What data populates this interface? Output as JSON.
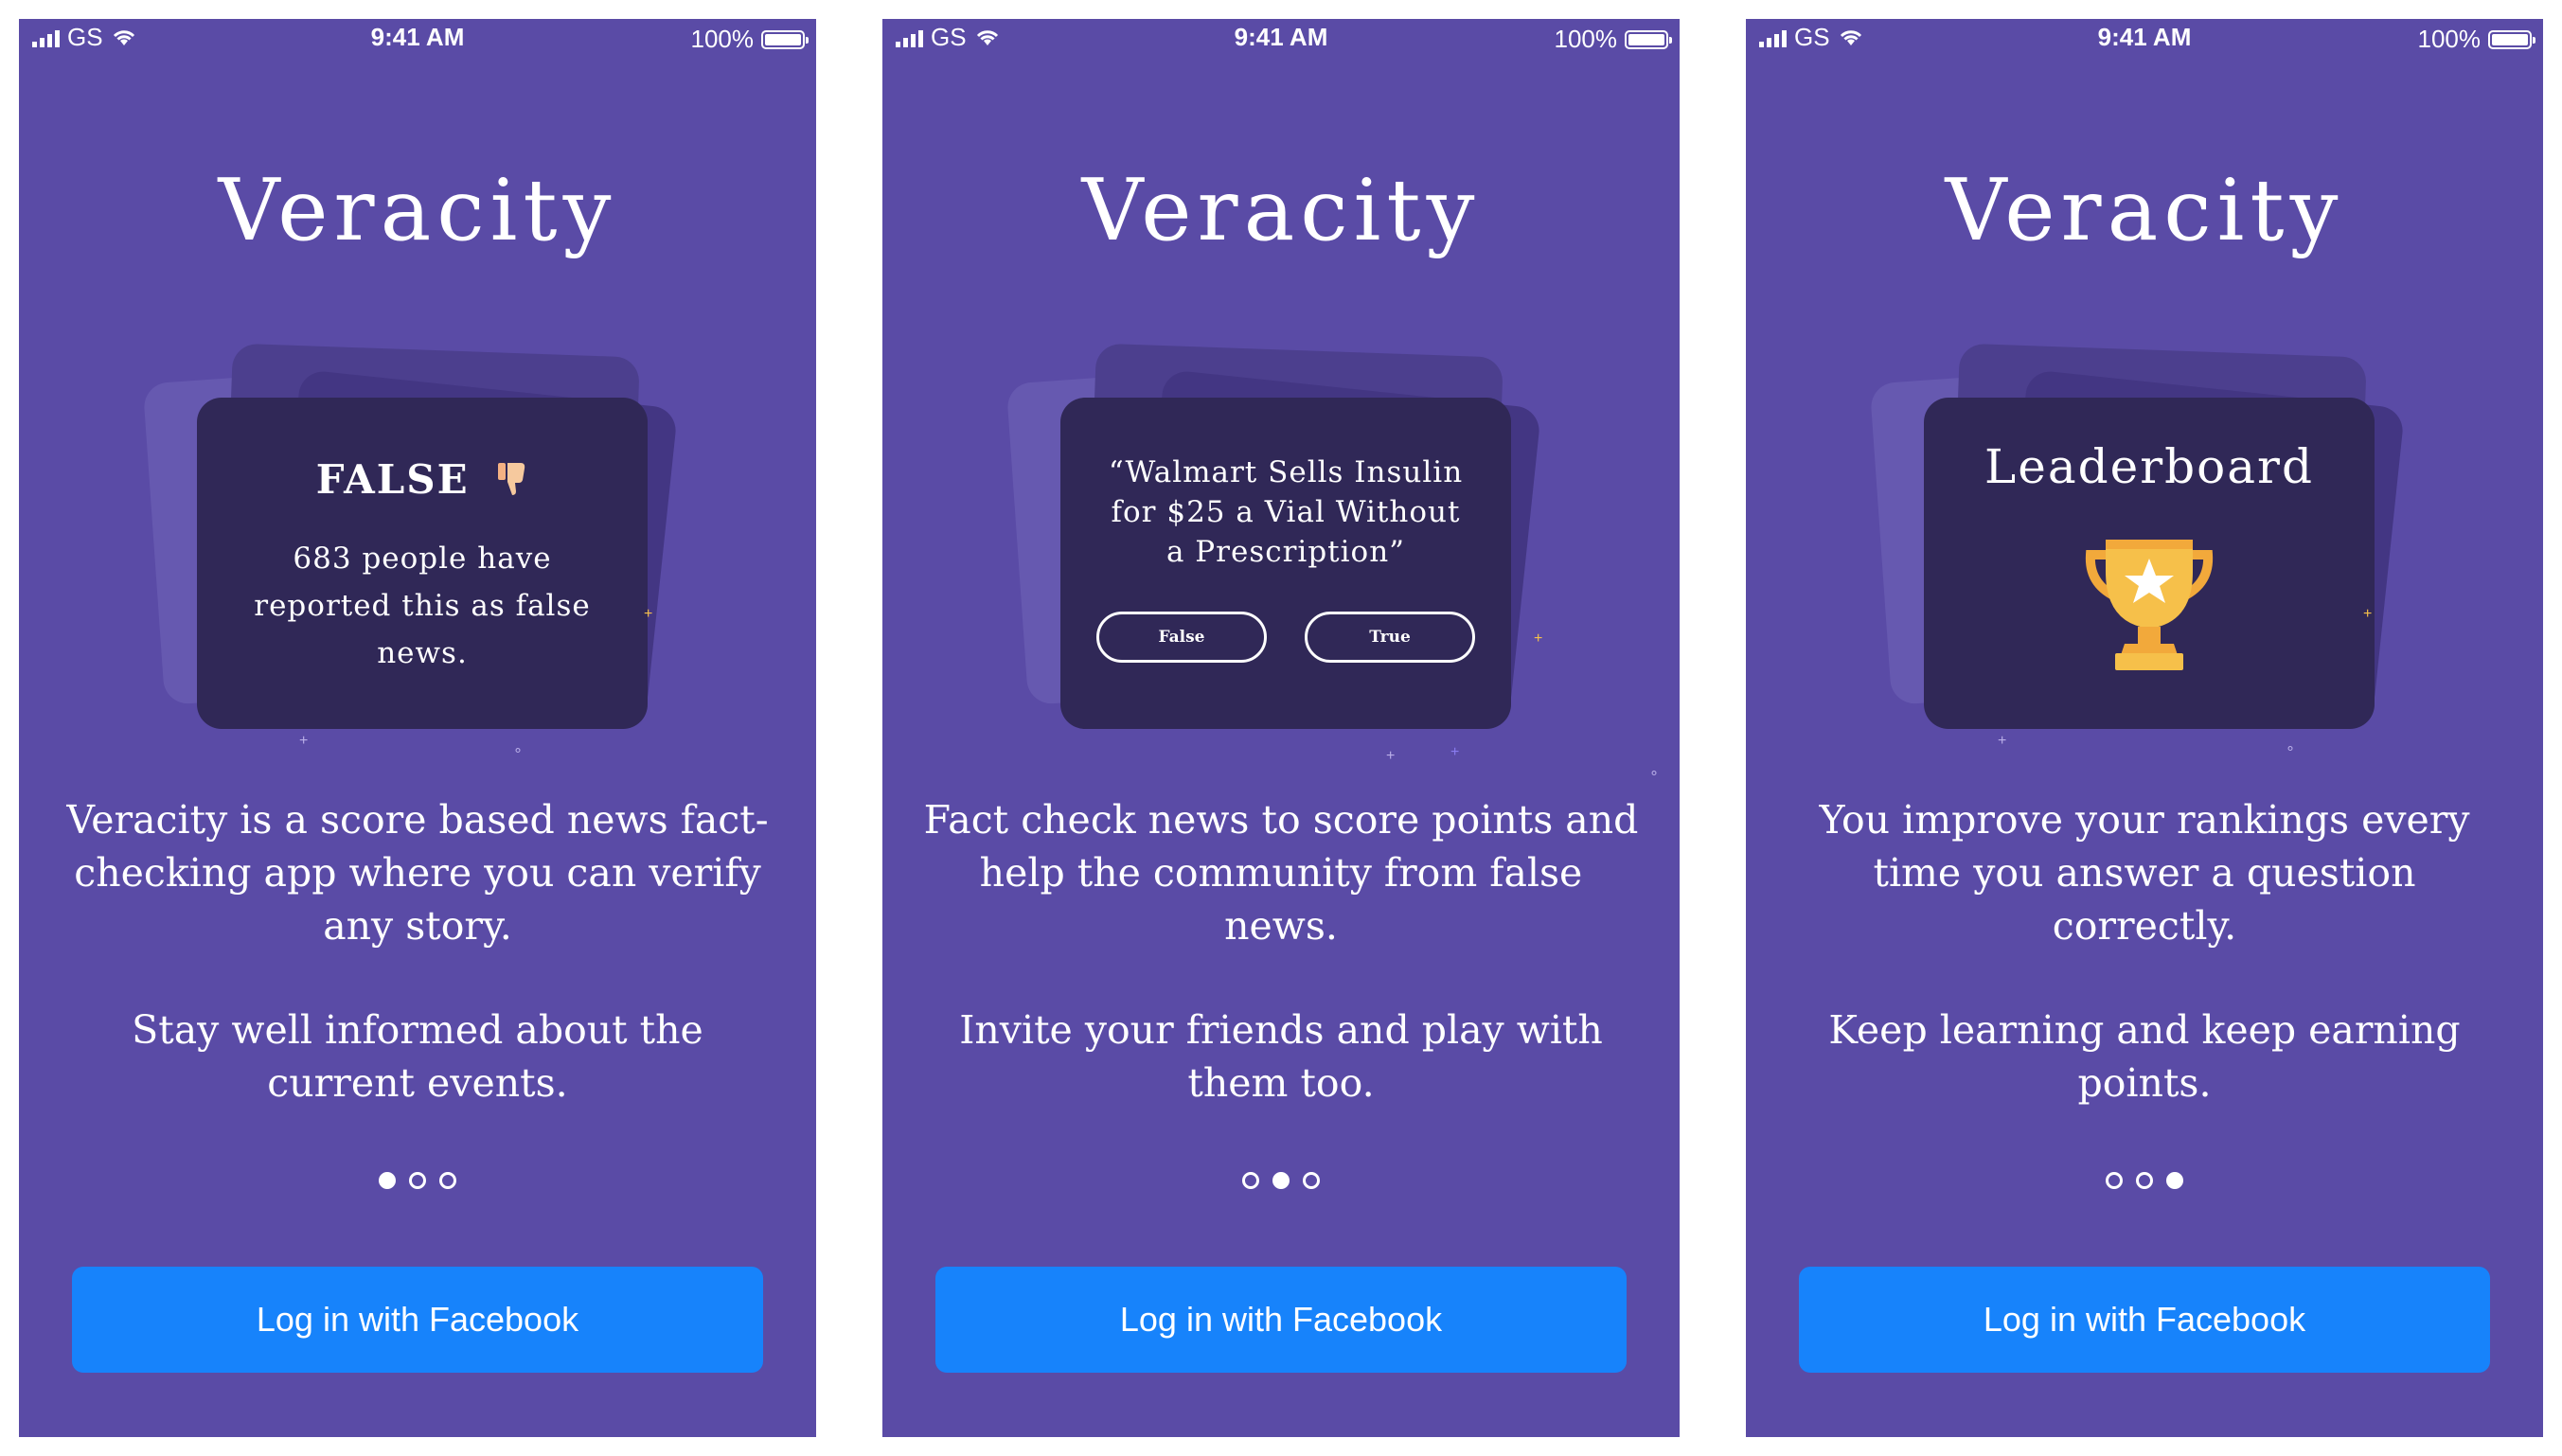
{
  "status": {
    "carrier": "GS",
    "time": "9:41 AM",
    "battery": "100%"
  },
  "app_title": "Veracity",
  "screens": [
    {
      "card": {
        "verdict": "FALSE",
        "verdict_icon": "thumbs-down-icon",
        "reported": "683 people have reported this as false news."
      },
      "description": "Veracity is a score based news fact-checking app where you can verify any story.",
      "description_2": "Stay well informed about the current events.",
      "active_page": 1
    },
    {
      "card": {
        "quote": "“Walmart Sells Insulin for $25 a Vial Without a Prescription”",
        "false_label": "False",
        "true_label": "True"
      },
      "description": "Fact check news to score points and help the community from false news.",
      "description_2": "Invite your friends and play with them too.",
      "active_page": 2
    },
    {
      "card": {
        "title": "Leaderboard",
        "icon": "trophy-icon"
      },
      "description": "You improve your rankings every time you answer a question correctly.",
      "description_2": "Keep learning and keep earning points.",
      "active_page": 3
    }
  ],
  "page_count": 3,
  "login_button_label": "Log in with Facebook",
  "colors": {
    "background": "#5a4ba6",
    "card": "#302857",
    "facebook": "#1783fb",
    "trophy": "#f6c04a"
  }
}
